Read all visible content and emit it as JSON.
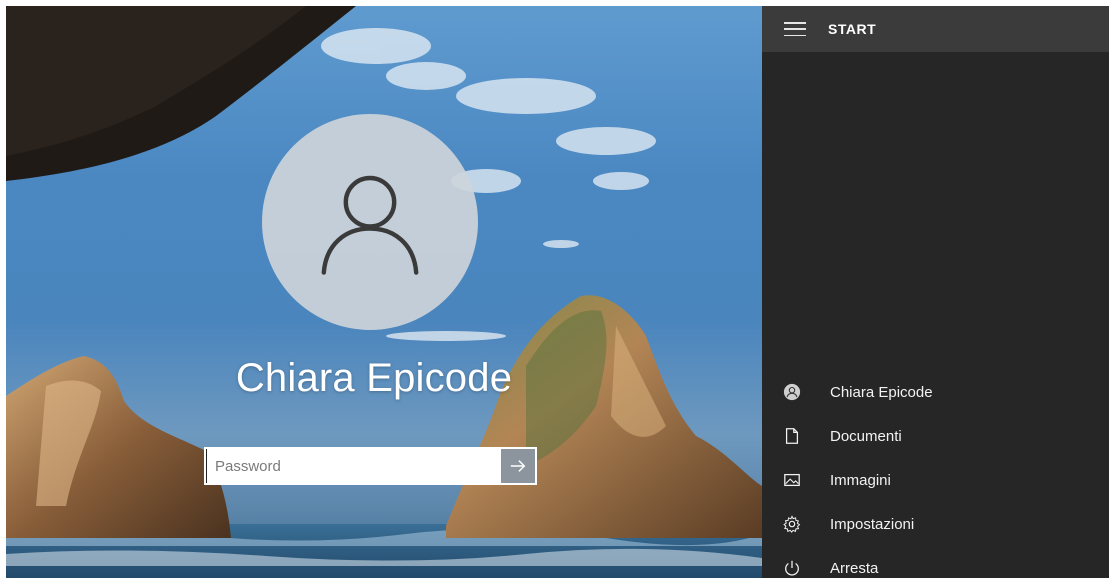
{
  "lock_screen": {
    "user_name": "Chiara Epicode",
    "password_placeholder": "Password",
    "password_value": ""
  },
  "start_panel": {
    "title": "START",
    "items": [
      {
        "label": "Chiara Epicode",
        "icon": "user-avatar-icon"
      },
      {
        "label": "Documenti",
        "icon": "document-icon"
      },
      {
        "label": "Immagini",
        "icon": "image-icon"
      },
      {
        "label": "Impostazioni",
        "icon": "gear-icon"
      },
      {
        "label": "Arresta",
        "icon": "power-icon"
      }
    ]
  },
  "colors": {
    "panel_bg": "#262626",
    "panel_header_bg": "#3b3b3b",
    "text_light": "#f2f2f2"
  }
}
